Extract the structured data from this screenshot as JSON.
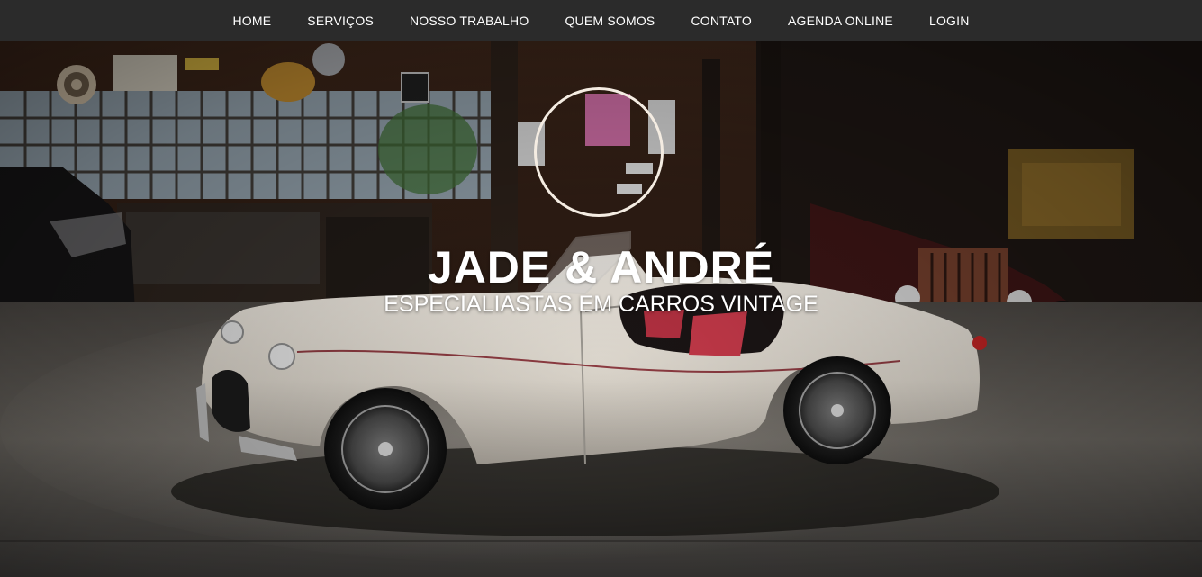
{
  "nav": {
    "items": [
      {
        "label": "HOME"
      },
      {
        "label": "SERVIÇOS"
      },
      {
        "label": "NOSSO TRABALHO"
      },
      {
        "label": "QUEM SOMOS"
      },
      {
        "label": "CONTATO"
      },
      {
        "label": "AGENDA ONLINE"
      },
      {
        "label": "LOGIN"
      }
    ]
  },
  "hero": {
    "title": "JADE & ANDRÉ",
    "subtitle": "ESPECIALIASTAS EM CARROS VINTAGE"
  },
  "colors": {
    "navbar_bg": "#2b2b2b",
    "nav_text": "#ffffff",
    "logo_ring": "#f4ece2"
  }
}
